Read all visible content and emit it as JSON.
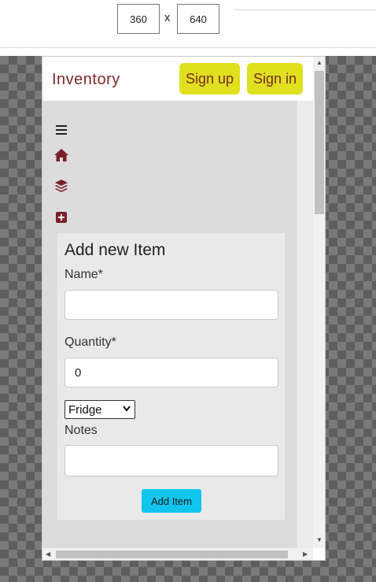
{
  "devtools": {
    "width_value": "360",
    "separator": "x",
    "height_value": "640"
  },
  "navbar": {
    "brand": "Inventory",
    "signup_label": "Sign up",
    "signin_label": "Sign in"
  },
  "sidebar": {
    "icons": [
      "menu-icon",
      "home-icon",
      "layers-icon",
      "add-box-icon"
    ]
  },
  "form": {
    "title": "Add new Item",
    "name_label": "Name*",
    "name_value": "",
    "quantity_label": "Quantity*",
    "quantity_value": "0",
    "location_selected": "Fridge",
    "notes_label": "Notes",
    "notes_value": "",
    "submit_label": "Add Item"
  },
  "colors": {
    "brand_text": "#7a2a2a",
    "nav_button_bg": "#dfe01e",
    "submit_bg": "#11c5ee"
  }
}
